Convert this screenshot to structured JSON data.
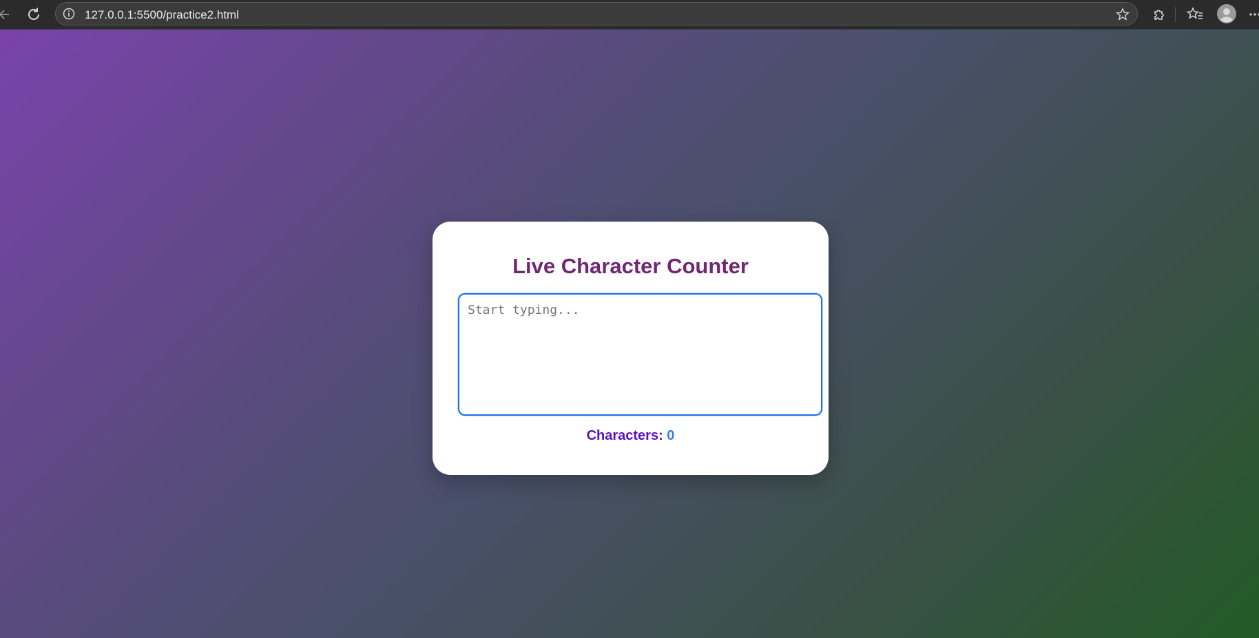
{
  "browser": {
    "url": "127.0.0.1:5500/practice2.html",
    "icons": [
      "back-arrow-icon",
      "reload-icon",
      "info-icon",
      "star-icon",
      "extensions-icon",
      "favorites-icon",
      "profile-icon",
      "more-icon"
    ]
  },
  "page": {
    "title": "Live Character Counter",
    "textarea": {
      "placeholder": "Start typing...",
      "value": ""
    },
    "counter": {
      "label": "Characters:",
      "value": "0"
    }
  },
  "colors": {
    "title": "#6f2872",
    "counter_label": "#5b0fbf",
    "counter_value": "#2f7fe0",
    "focus_border": "#1a73e8",
    "gradient_start": "#7a43ab",
    "gradient_end": "#235a27"
  }
}
